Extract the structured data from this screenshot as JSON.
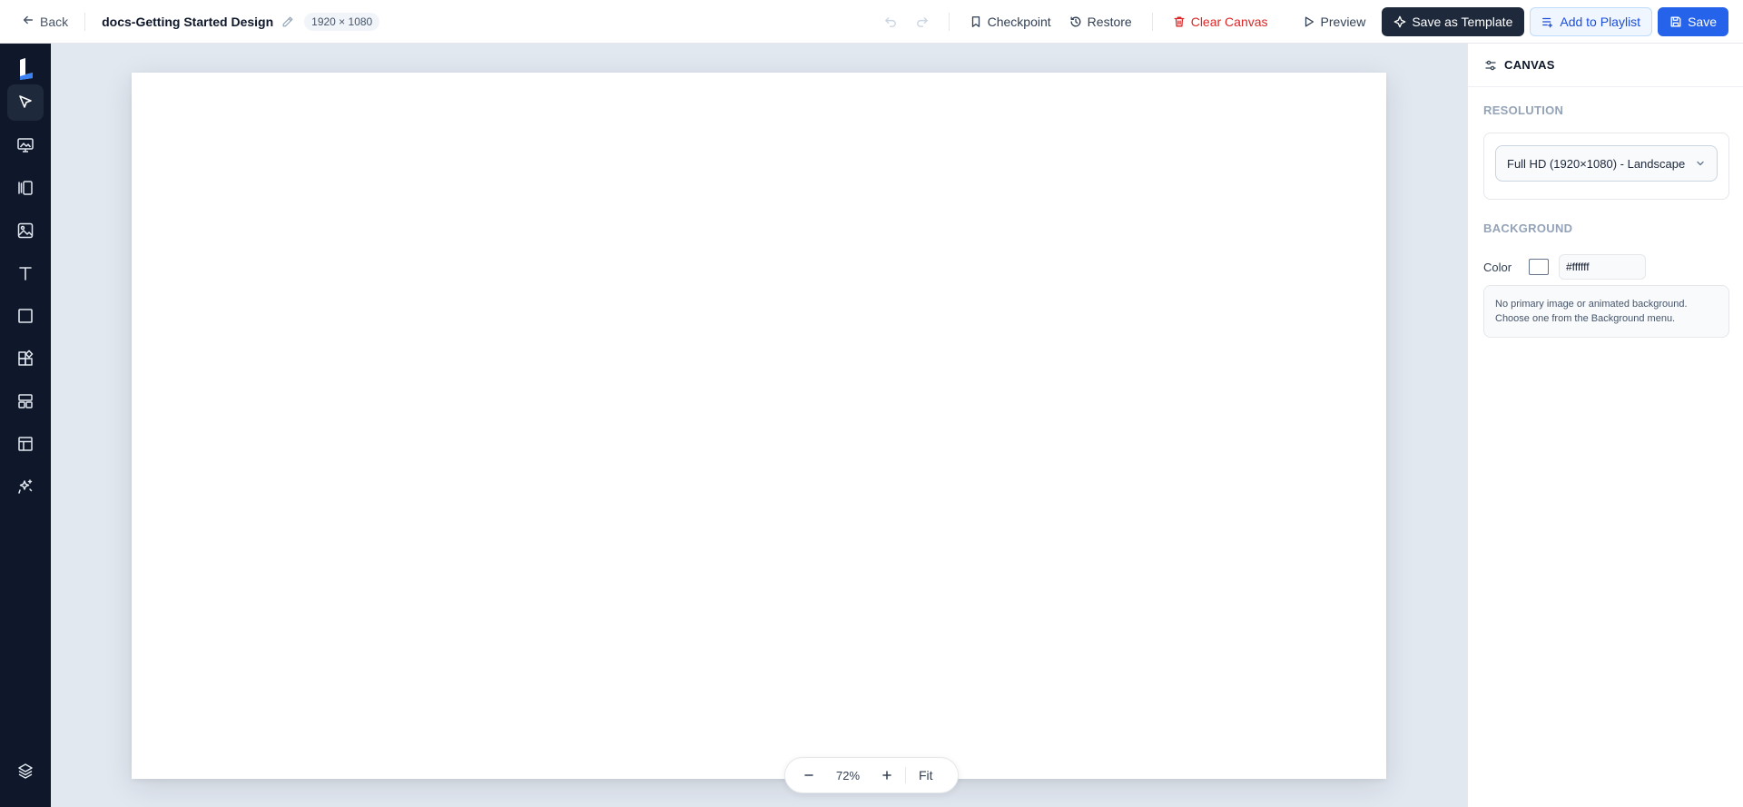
{
  "header": {
    "back_label": "Back",
    "document_title": "docs-Getting Started Design",
    "resolution_badge": "1920 × 1080",
    "checkpoint_label": "Checkpoint",
    "restore_label": "Restore",
    "clear_canvas_label": "Clear Canvas",
    "preview_label": "Preview",
    "save_template_label": "Save as Template",
    "add_playlist_label": "Add to Playlist",
    "save_label": "Save"
  },
  "sidebar": {
    "items": [
      {
        "icon": "pointer-icon",
        "active": true
      },
      {
        "icon": "monitor-image-icon"
      },
      {
        "icon": "columns-icon"
      },
      {
        "icon": "image-icon"
      },
      {
        "icon": "text-icon"
      },
      {
        "icon": "square-icon"
      },
      {
        "icon": "widgets-icon"
      },
      {
        "icon": "layout-icon"
      },
      {
        "icon": "template-icon"
      },
      {
        "icon": "sparkles-icon"
      },
      {
        "icon": "layers-icon"
      }
    ]
  },
  "canvas": {
    "background_color": "#ffffff",
    "zoom": "72%",
    "fit_label": "Fit"
  },
  "panel": {
    "title": "CANVAS",
    "resolution_section": "RESOLUTION",
    "resolution_value": "Full HD (1920×1080) - Landscape",
    "background_section": "BACKGROUND",
    "color_label": "Color",
    "color_value": "#ffffff",
    "note_line1": "No primary image or animated background.",
    "note_line2": "Choose one from the Background menu."
  },
  "colors": {
    "accent": "#2563eb",
    "dark_button": "#1e293b",
    "danger": "#dc2626",
    "rail": "#0f172a",
    "workspace": "#e2e8f0"
  }
}
